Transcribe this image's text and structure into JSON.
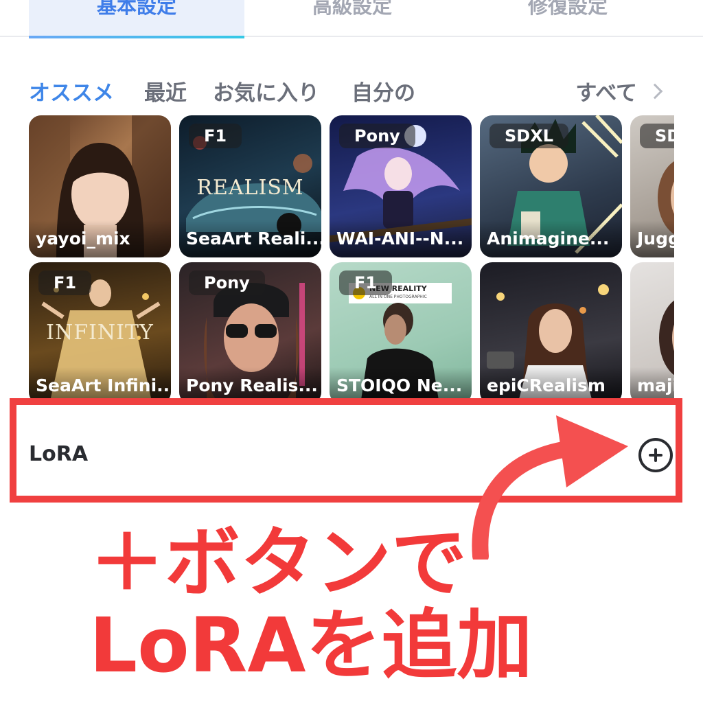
{
  "top_tabs": [
    {
      "label": "基本設定",
      "active": true
    },
    {
      "label": "高級設定",
      "active": false
    },
    {
      "label": "修復設定",
      "active": false
    }
  ],
  "categories": {
    "items": [
      "オススメ",
      "最近",
      "お気に入り",
      "自分の"
    ],
    "active": "オススメ",
    "all_label": "すべて"
  },
  "models": [
    {
      "name": "yayoi_mix",
      "tag": ""
    },
    {
      "name": "SeaArt Reali...",
      "tag": "F1",
      "overlay": "REALISM"
    },
    {
      "name": "WAI-ANI--N...",
      "tag": "Pony"
    },
    {
      "name": "Animagine...",
      "tag": "SDXL"
    },
    {
      "name": "Jugg",
      "tag": "SDX"
    },
    {
      "name": "SeaArt Infini...",
      "tag": "F1",
      "overlay": "INFINITY"
    },
    {
      "name": "Pony Realis...",
      "tag": "Pony"
    },
    {
      "name": "STOIQO Ne...",
      "tag": "F1",
      "overlay": "NEW REALITY",
      "overlay_sub": "ALL IN ONE PHOTOGRAPHIC"
    },
    {
      "name": "epiCRealism",
      "tag": ""
    },
    {
      "name": "maji",
      "tag": ""
    }
  ],
  "lora": {
    "label": "LoRA",
    "add_icon": "plus-circle-icon"
  },
  "annotation": {
    "line1": "＋ボタンで",
    "line2": "LoRAを追加"
  },
  "colors": {
    "accent": "#3f86e8",
    "highlight": "#f04040",
    "annotation": "#f23a3a"
  }
}
